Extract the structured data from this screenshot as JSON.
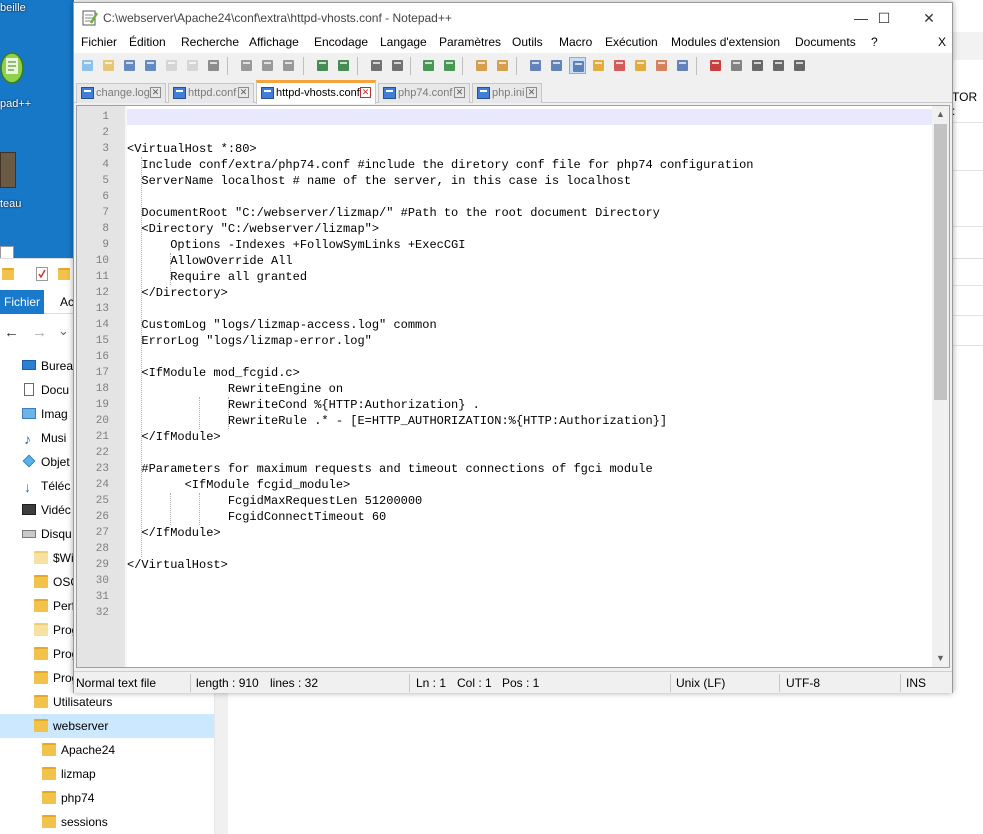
{
  "desktop": {
    "icons": [
      {
        "label": "beille",
        "icon": "recycle-bin-icon"
      },
      {
        "label": "pad++",
        "icon": "notepadpp-shortcut-icon"
      },
      {
        "label": "teau",
        "icon": "image-shortcut-icon"
      }
    ]
  },
  "explorer": {
    "ribbon_tabs": [
      "Fichier",
      "Ac"
    ],
    "nav": {
      "back": "←",
      "forward": "→",
      "dropdown": "⌄"
    },
    "right_pane_fragment": "TOR :",
    "tree": [
      {
        "label": "Burea",
        "icon": "desktop-icon"
      },
      {
        "label": "Docu",
        "icon": "documents-icon"
      },
      {
        "label": "Imag",
        "icon": "pictures-icon"
      },
      {
        "label": "Musi",
        "icon": "music-icon"
      },
      {
        "label": "Objet",
        "icon": "3d-objects-icon"
      },
      {
        "label": "Téléc",
        "icon": "downloads-icon"
      },
      {
        "label": "Vidéc",
        "icon": "videos-icon"
      },
      {
        "label": "Disqu",
        "icon": "drive-icon"
      },
      {
        "label": "$Wi",
        "icon": "folder-icon"
      },
      {
        "label": "OSG",
        "icon": "folder-icon"
      },
      {
        "label": "Perf",
        "icon": "folder-icon"
      },
      {
        "label": "Prog",
        "icon": "folder-icon"
      },
      {
        "label": "Prog",
        "icon": "folder-icon"
      },
      {
        "label": "Prog",
        "icon": "folder-icon"
      },
      {
        "label": "Utilisateurs",
        "icon": "folder-icon"
      },
      {
        "label": "webserver",
        "icon": "folder-icon",
        "selected": true
      },
      {
        "label": "Apache24",
        "icon": "folder-icon"
      },
      {
        "label": "lizmap",
        "icon": "folder-icon"
      },
      {
        "label": "php74",
        "icon": "folder-icon"
      },
      {
        "label": "sessions",
        "icon": "folder-icon"
      }
    ]
  },
  "npp": {
    "title": "C:\\webserver\\Apache24\\conf\\extra\\httpd-vhosts.conf - Notepad++",
    "window_buttons": {
      "minimize": "—",
      "maximize": "☐",
      "close": "✕"
    },
    "menu": [
      "Fichier",
      "Édition",
      "Recherche",
      "Affichage",
      "Encodage",
      "Langage",
      "Paramètres",
      "Outils",
      "Macro",
      "Exécution",
      "Modules d'extension",
      "Documents",
      "?"
    ],
    "menu_close": "X",
    "toolbar": [
      {
        "icon": "new-file-icon"
      },
      {
        "icon": "open-file-icon"
      },
      {
        "icon": "save-icon"
      },
      {
        "icon": "save-all-icon"
      },
      {
        "icon": "close-icon"
      },
      {
        "icon": "close-all-icon"
      },
      {
        "icon": "print-icon"
      },
      {
        "icon": "cut-icon"
      },
      {
        "icon": "copy-icon"
      },
      {
        "icon": "paste-icon"
      },
      {
        "icon": "undo-icon"
      },
      {
        "icon": "redo-icon"
      },
      {
        "icon": "find-icon"
      },
      {
        "icon": "replace-icon"
      },
      {
        "icon": "zoom-in-icon"
      },
      {
        "icon": "zoom-out-icon"
      },
      {
        "icon": "sync-vertical-icon"
      },
      {
        "icon": "sync-horizontal-icon"
      },
      {
        "icon": "word-wrap-icon"
      },
      {
        "icon": "show-all-chars-icon"
      },
      {
        "icon": "indent-guide-icon"
      },
      {
        "icon": "udl-icon"
      },
      {
        "icon": "doc-map-icon"
      },
      {
        "icon": "function-list-icon"
      },
      {
        "icon": "folder-as-workspace-icon"
      },
      {
        "icon": "monitoring-icon"
      },
      {
        "icon": "record-macro-icon"
      },
      {
        "icon": "stop-macro-icon"
      },
      {
        "icon": "play-macro-icon"
      },
      {
        "icon": "run-macro-multiple-icon"
      },
      {
        "icon": "save-macro-icon"
      }
    ],
    "tabs": [
      {
        "label": "change.log",
        "active": false
      },
      {
        "label": "httpd.conf",
        "active": false
      },
      {
        "label": "httpd-vhosts.conf",
        "active": true
      },
      {
        "label": "php74.conf",
        "active": false
      },
      {
        "label": "php.ini",
        "active": false
      }
    ],
    "tab_close_glyph": "✕",
    "code_lines": [
      "",
      "",
      "<VirtualHost *:80>",
      "  Include conf/extra/php74.conf #include the diretory conf file for php74 configuration",
      "  ServerName localhost # name of the server, in this case is localhost",
      "",
      "  DocumentRoot \"C:/webserver/lizmap/\" #Path to the root document Directory",
      "  <Directory \"C:/webserver/lizmap\">",
      "      Options -Indexes +FollowSymLinks +ExecCGI",
      "      AllowOverride All",
      "      Require all granted",
      "  </Directory>",
      "",
      "  CustomLog \"logs/lizmap-access.log\" common",
      "  ErrorLog \"logs/lizmap-error.log\"",
      "",
      "  <IfModule mod_fcgid.c>",
      "              RewriteEngine on",
      "              RewriteCond %{HTTP:Authorization} .",
      "              RewriteRule .* - [E=HTTP_AUTHORIZATION:%{HTTP:Authorization}]",
      "  </IfModule>",
      "",
      "  #Parameters for maximum requests and timeout connections of fgci module",
      "        <IfModule fcgid_module>",
      "              FcgidMaxRequestLen 51200000",
      "              FcgidConnectTimeout 60",
      "  </IfModule>",
      "",
      "</VirtualHost>",
      "",
      "",
      ""
    ],
    "scroll": {
      "up": "▲",
      "down": "▼"
    },
    "status": {
      "type": "Normal text file",
      "length": "length : 910",
      "lines": "lines : 32",
      "ln": "Ln : 1",
      "col": "Col : 1",
      "pos": "Pos : 1",
      "eol": "Unix (LF)",
      "encoding": "UTF-8",
      "mode": "INS"
    }
  }
}
